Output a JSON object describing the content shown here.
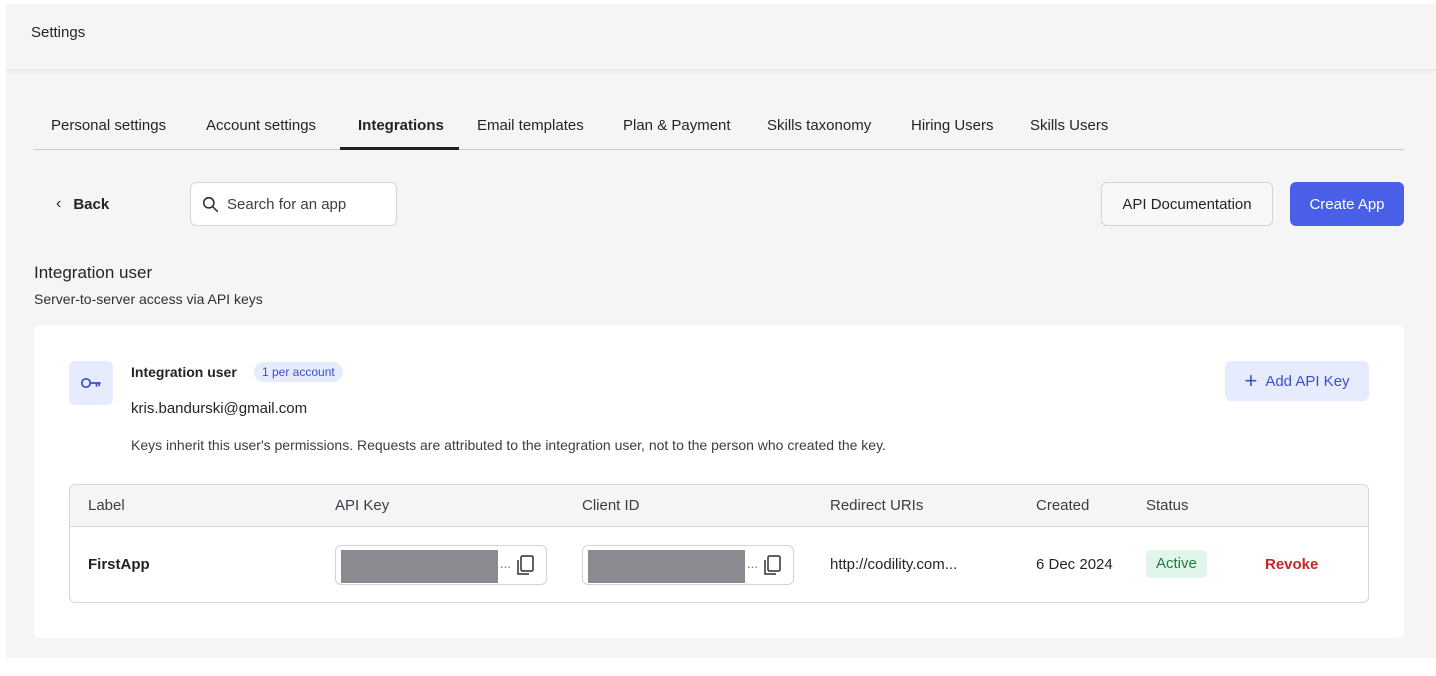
{
  "header": {
    "title": "Settings"
  },
  "tabs": [
    {
      "label": "Personal settings",
      "active": false
    },
    {
      "label": "Account settings",
      "active": false
    },
    {
      "label": "Integrations",
      "active": true
    },
    {
      "label": "Email templates",
      "active": false
    },
    {
      "label": "Plan & Payment",
      "active": false
    },
    {
      "label": "Skills taxonomy",
      "active": false
    },
    {
      "label": "Hiring Users",
      "active": false
    },
    {
      "label": "Skills Users",
      "active": false
    }
  ],
  "toolbar": {
    "back_label": "Back",
    "search_placeholder": "Search for an app",
    "api_docs_label": "API Documentation",
    "create_app_label": "Create App"
  },
  "section": {
    "title": "Integration user",
    "subtitle": "Server-to-server access via API keys"
  },
  "integration_user": {
    "name": "Integration user",
    "badge": "1 per account",
    "email": "kris.bandurski@gmail.com",
    "note": "Keys inherit this user's permissions. Requests are attributed to the integration user, not to the person who created the key.",
    "add_key_label": "Add API Key"
  },
  "table": {
    "columns": [
      "Label",
      "API Key",
      "Client ID",
      "Redirect URIs",
      "Created",
      "Status"
    ],
    "rows": [
      {
        "label": "FirstApp",
        "api_key_ellipsis": "...",
        "client_id_ellipsis": "...",
        "redirect_uri": "http://codility.com...",
        "created": "6 Dec 2024",
        "status": "Active",
        "action": "Revoke"
      }
    ]
  },
  "colors": {
    "primary": "#4a5fe8",
    "accent_soft": "#e6ebfd",
    "status_active_bg": "#e2f5ea",
    "status_active_text": "#1f7a45",
    "danger": "#c62828"
  },
  "icons": [
    "search-icon",
    "chevron-left-icon",
    "key-icon",
    "plus-icon",
    "copy-icon"
  ]
}
